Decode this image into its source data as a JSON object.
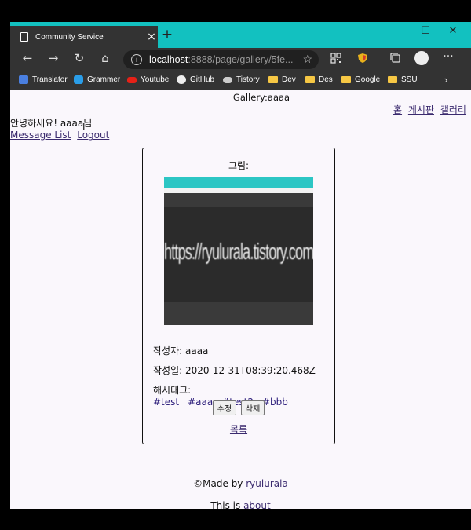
{
  "browser": {
    "tab_title": "Community Service",
    "url_host": "localhost",
    "url_rest": ":8888/page/gallery/5fe...",
    "bookmarks": [
      "Translator",
      "Grammer",
      "Youtube",
      "GitHub",
      "Tistory",
      "Dev",
      "Des",
      "Google",
      "SSU"
    ]
  },
  "header": {
    "title": "Gallery:aaaa",
    "nav": [
      "홈",
      "게시판",
      "갤러리"
    ]
  },
  "user": {
    "greeting": "안녕하세요! aaaa님",
    "links": [
      "Message List",
      "Logout"
    ]
  },
  "card": {
    "image_label": "그림:",
    "image_text": "https://ryulurala.tistory.com",
    "author_label": "작성자:",
    "author": "aaaa",
    "date_label": "작성일:",
    "date": "2020-12-31T08:39:20.468Z",
    "tags_label": "해시태그:",
    "tags": [
      "#test",
      "#aaa",
      "#test2",
      "#bbb"
    ],
    "edit_button": "수정",
    "delete_button": "삭제",
    "back_link": "목록"
  },
  "footer": {
    "made_by": "©Made by",
    "author_link": "ryulurala",
    "this_is": "This is",
    "about_link": "about"
  },
  "colors": {
    "titlebar": "#12c1c0",
    "toolbar": "#333333",
    "link": "#3a2a6e"
  }
}
